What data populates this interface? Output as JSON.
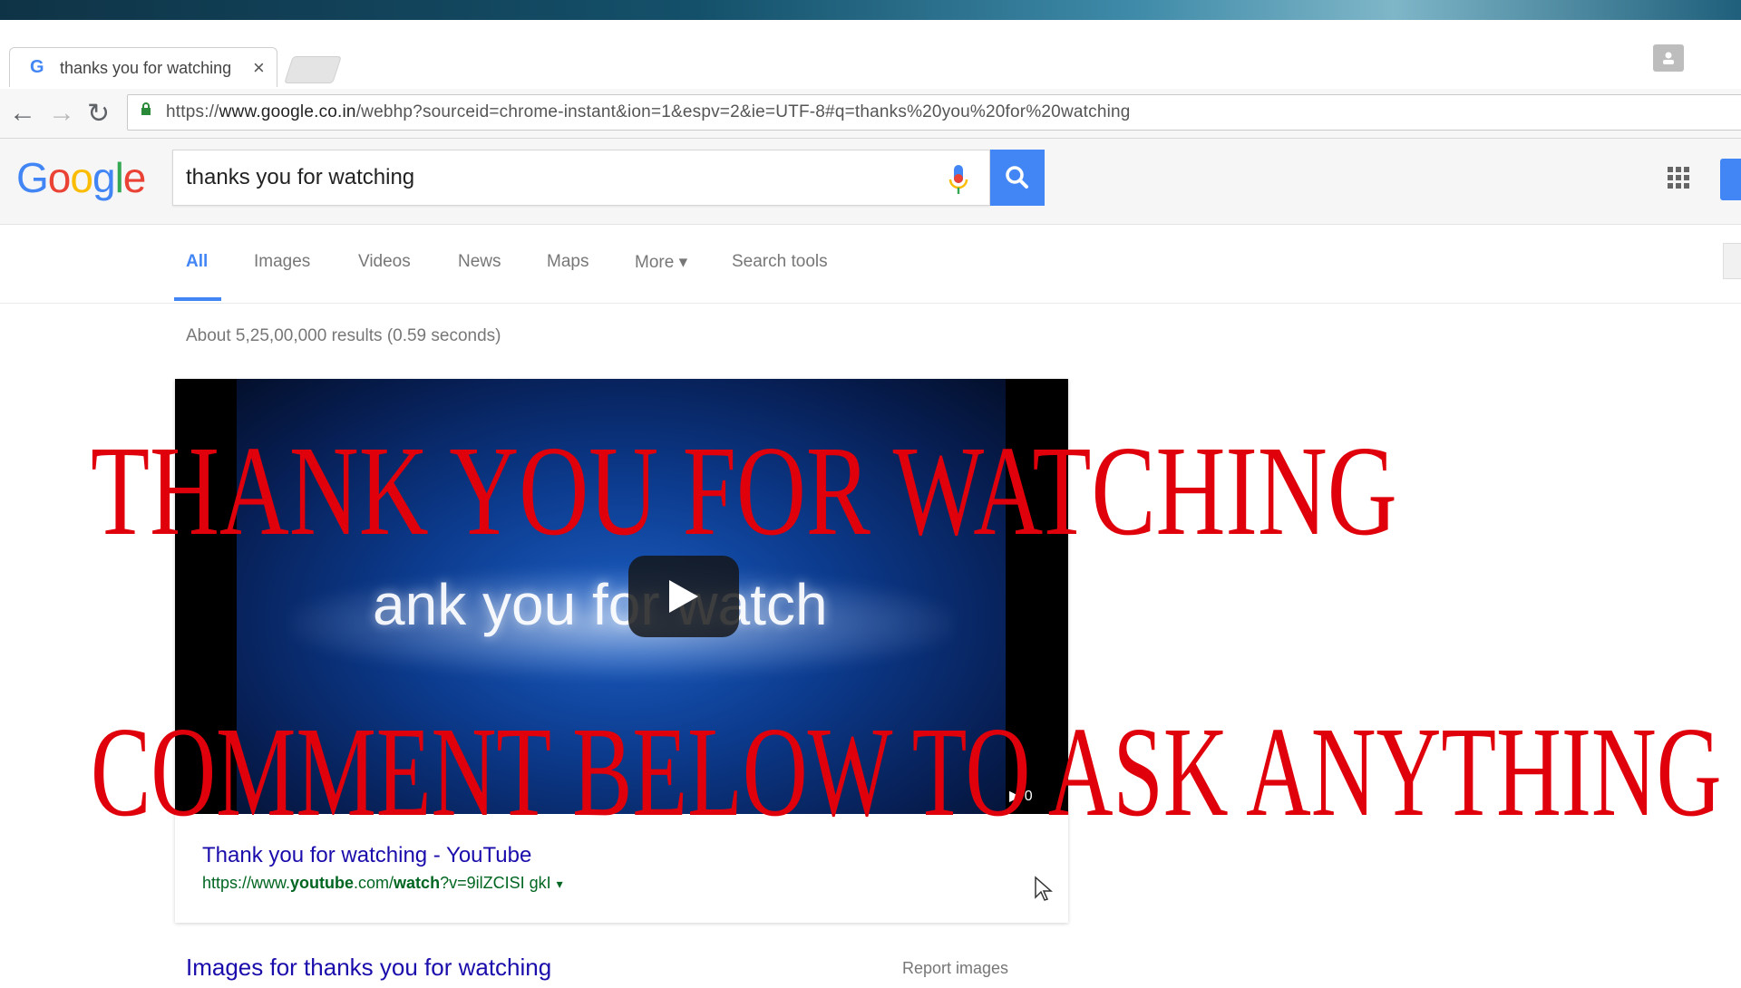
{
  "browser": {
    "tab": {
      "favicon": "G",
      "title": "thanks you for watching",
      "close": "×"
    },
    "nav": {
      "back": "←",
      "forward": "→",
      "reload": "↻"
    },
    "url": {
      "scheme": "https://",
      "host": "www.google.co.in",
      "rest": "/webhp?sourceid=chrome-instant&ion=1&espv=2&ie=UTF-8#q=thanks%20you%20for%20watching"
    }
  },
  "google": {
    "logo": [
      "G",
      "o",
      "o",
      "g",
      "l",
      "e"
    ],
    "logo_colors": [
      "#4285f4",
      "#ea4335",
      "#fbbc05",
      "#4285f4",
      "#34a853",
      "#ea4335"
    ],
    "search_query": "thanks you for watching",
    "tabs": [
      {
        "label": "All",
        "active": true
      },
      {
        "label": "Images"
      },
      {
        "label": "Videos"
      },
      {
        "label": "News"
      },
      {
        "label": "Maps"
      },
      {
        "label": "More ▾"
      },
      {
        "label": "Search tools"
      }
    ],
    "results_stats": "About 5,25,00,000 results (0.59 seconds)"
  },
  "video_result": {
    "thumbnail_text": "ank you for watch",
    "duration": "▶ 0",
    "title": "Thank you for watching - YouTube",
    "url_prefix": "https://www.",
    "url_bold1": "youtube",
    "url_mid": ".com/",
    "url_bold2": "watch",
    "url_suffix": "?v=9ilZCISI gkI",
    "url_dropdown": "▾"
  },
  "images_section": {
    "heading": "Images for thanks you for watching",
    "report": "Report images"
  },
  "overlay": {
    "line1": "THANK YOU FOR WATCHING",
    "line2": "COMMENT BELOW TO ASK ANYTHING",
    "color": "#e0000b"
  }
}
